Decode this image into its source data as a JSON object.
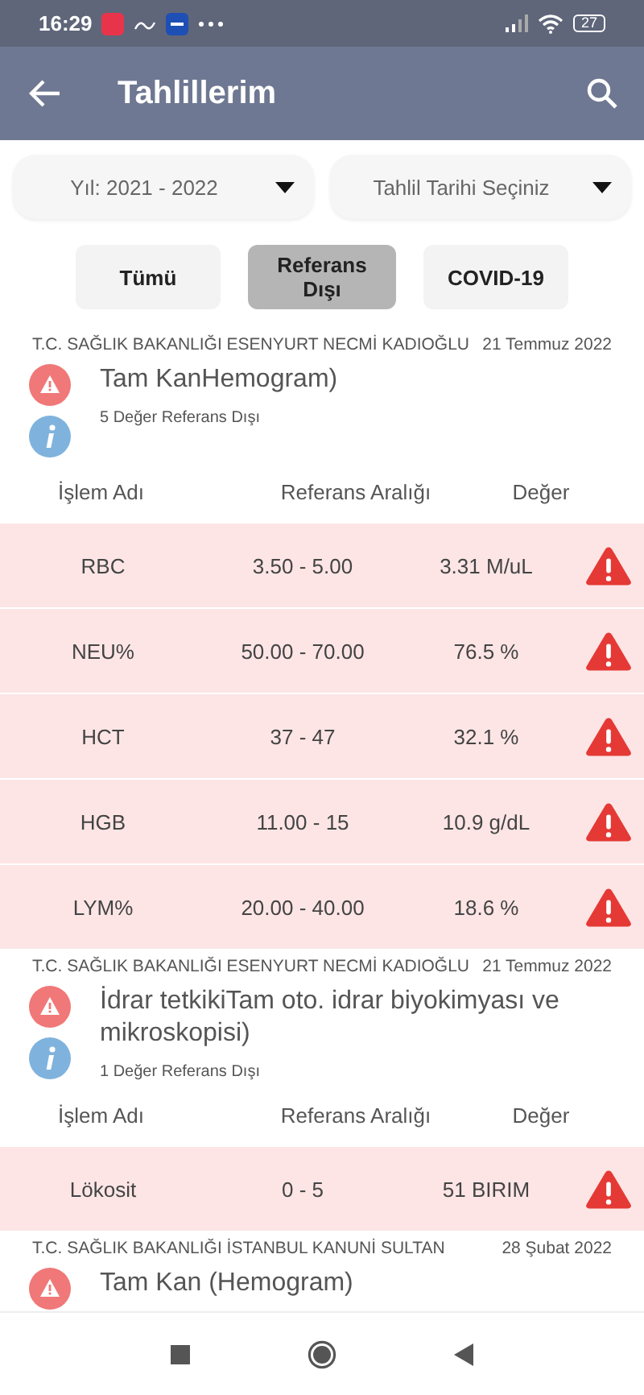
{
  "status_bar": {
    "time": "16:29",
    "battery": "27"
  },
  "app_bar": {
    "title": "Tahlillerim"
  },
  "filters": [
    {
      "label": "Yıl: 2021 - 2022"
    },
    {
      "label": "Tahlil Tarihi Seçiniz"
    }
  ],
  "tabs": [
    {
      "label": "Tümü",
      "selected": false
    },
    {
      "label": "Referans Dışı",
      "selected": true
    },
    {
      "label": "COVID-19",
      "selected": false
    }
  ],
  "results": [
    {
      "hospital": "T.C. SAĞLIK BAKANLIĞI ESENYURT NECMİ KADIOĞLU",
      "date": "21 Temmuz 2022",
      "test": "Tam KanHemogram)",
      "summary": "5 Değer Referans Dışı",
      "columns": [
        "İşlem Adı",
        "Referans Aralığı",
        "Değer"
      ],
      "rows": [
        {
          "name": "RBC",
          "range": "3.50 - 5.00",
          "value": "3.31 M/uL",
          "out_of_range": true
        },
        {
          "name": "NEU%",
          "range": "50.00 - 70.00",
          "value": "76.5 %",
          "out_of_range": true
        },
        {
          "name": "HCT",
          "range": "37 - 47",
          "value": "32.1 %",
          "out_of_range": true
        },
        {
          "name": "HGB",
          "range": "11.00 - 15",
          "value": "10.9 g/dL",
          "out_of_range": true
        },
        {
          "name": "LYM%",
          "range": "20.00 - 40.00",
          "value": "18.6 %",
          "out_of_range": true
        }
      ]
    },
    {
      "hospital": "T.C. SAĞLIK BAKANLIĞI ESENYURT NECMİ KADIOĞLU",
      "date": "21 Temmuz 2022",
      "test": "İdrar tetkikiTam oto. idrar biyokimyası ve mikroskopisi)",
      "summary": "1 Değer Referans Dışı",
      "columns": [
        "İşlem Adı",
        "Referans Aralığı",
        "Değer"
      ],
      "rows": [
        {
          "name": "Lökosit",
          "range": "0 - 5",
          "value": "51 BIRIM",
          "out_of_range": true
        }
      ]
    },
    {
      "hospital": "T.C. SAĞLIK BAKANLIĞI İSTANBUL KANUNİ SULTAN",
      "date": "28 Şubat 2022",
      "test": "Tam Kan (Hemogram)"
    }
  ]
}
